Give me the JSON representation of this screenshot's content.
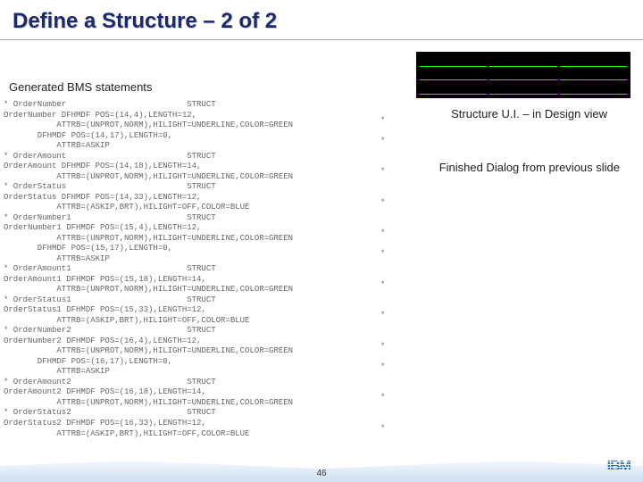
{
  "title": "Define a Structure – 2 of 2",
  "subtitle_left": "Generated BMS statements",
  "caption_1": "Structure U.I. – in Design view",
  "caption_2": "Finished Dialog from previous slide",
  "page_number": "46",
  "logo_text": "IBM",
  "code_lines": [
    "* OrderNumber                         STRUCT",
    "OrderNumber DFHMDF POS=(14,4),LENGTH=12,",
    "           ATTRB=(UNPROT,NORM),HILIGHT=UNDERLINE,COLOR=GREEN",
    "       DFHMDF POS=(14,17),LENGTH=0,",
    "           ATTRB=ASKIP",
    "* OrderAmount                         STRUCT",
    "OrderAmount DFHMDF POS=(14,18),LENGTH=14,",
    "           ATTRB=(UNPROT,NORM),HILIGHT=UNDERLINE,COLOR=GREEN",
    "* OrderStatus                         STRUCT",
    "OrderStatus DFHMDF POS=(14,33),LENGTH=12,",
    "           ATTRB=(ASKIP,BRT),HILIGHT=OFF,COLOR=BLUE",
    "* OrderNumber1                        STRUCT",
    "OrderNumber1 DFHMDF POS=(15,4),LENGTH=12,",
    "           ATTRB=(UNPROT,NORM),HILIGHT=UNDERLINE,COLOR=GREEN",
    "       DFHMDF POS=(15,17),LENGTH=0,",
    "           ATTRB=ASKIP",
    "* OrderAmount1                        STRUCT",
    "OrderAmount1 DFHMDF POS=(15,18),LENGTH=14,",
    "           ATTRB=(UNPROT,NORM),HILIGHT=UNDERLINE,COLOR=GREEN",
    "* OrderStatus1                        STRUCT",
    "OrderStatus1 DFHMDF POS=(15,33),LENGTH=12,",
    "           ATTRB=(ASKIP,BRT),HILIGHT=OFF,COLOR=BLUE",
    "* OrderNumber2                        STRUCT",
    "OrderNumber2 DFHMDF POS=(16,4),LENGTH=12,",
    "           ATTRB=(UNPROT,NORM),HILIGHT=UNDERLINE,COLOR=GREEN",
    "       DFHMDF POS=(16,17),LENGTH=0,",
    "           ATTRB=ASKIP",
    "* OrderAmount2                        STRUCT",
    "OrderAmount2 DFHMDF POS=(16,18),LENGTH=14,",
    "           ATTRB=(UNPROT,NORM),HILIGHT=UNDERLINE,COLOR=GREEN",
    "* OrderStatus2                        STRUCT",
    "OrderStatus2 DFHMDF POS=(16,33),LENGTH=12,",
    "           ATTRB=(ASKIP,BRT),HILIGHT=OFF,COLOR=BLUE"
  ],
  "bullet_lines": [
    "",
    "*",
    "",
    "*",
    "",
    "",
    "*",
    "",
    "",
    "*",
    "",
    "",
    "*",
    "",
    "*",
    "",
    "",
    "*",
    "",
    "",
    "*",
    "",
    "",
    "*",
    "",
    "*",
    "",
    "",
    "*",
    "",
    "",
    "*",
    ""
  ]
}
